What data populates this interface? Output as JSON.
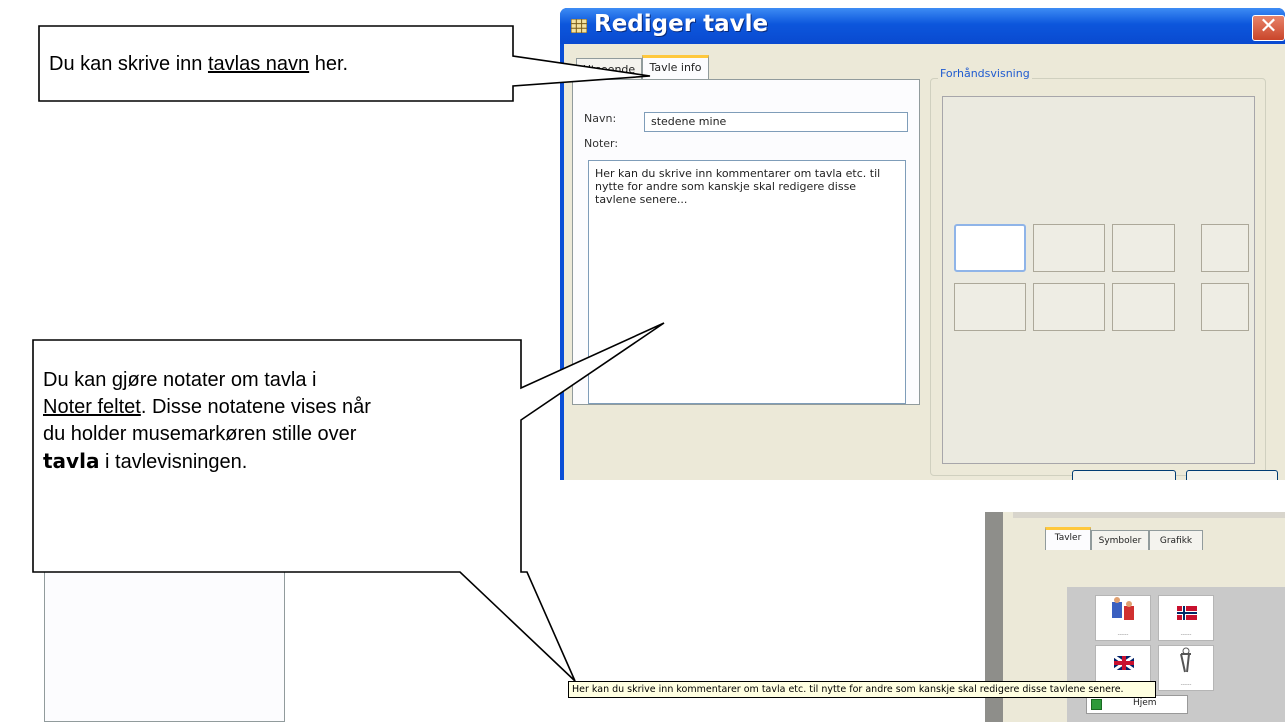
{
  "dialog": {
    "title": "Rediger tavle",
    "tabs": [
      "Utseende",
      "Tavle info"
    ],
    "active_tab": "Tavle info",
    "name_label": "Navn:",
    "name_value": "stedene mine",
    "notes_label": "Noter:",
    "notes_value": "Her kan du skrive inn kommentarer om tavla etc. til\nnytte for andre som kanskje skal redigere disse\ntavlene senere...",
    "preview_label": "Forhåndsvisning"
  },
  "callouts": {
    "top_before": "Du kan skrive inn ",
    "top_underline": "tavlas navn",
    "top_after": " her.",
    "bottom_line1": "Du kan gjøre notater om tavla i",
    "bottom_underline": "Noter feltet",
    "bottom_line2_after": ". Disse notatene vises når",
    "bottom_line3": "du holder musemarkøren stille over",
    "bottom_bold": "tavla",
    "bottom_line4_after": " i tavlevisningen."
  },
  "secondary": {
    "tabs": [
      "Tavler",
      "Symboler",
      "Grafikk"
    ],
    "home_label": "Hjem",
    "tooltip": "Her kan du skrive inn kommentarer om tavla etc. til nytte for andre som kanskje skal redigere disse tavlene senere."
  },
  "colors": {
    "titlebar": "#0a4ed6",
    "dialog_bg": "#ece9d8",
    "active_tab_accent": "#ffc83c",
    "tooltip_bg": "#ffffe1",
    "close_button": "#c9452a"
  }
}
